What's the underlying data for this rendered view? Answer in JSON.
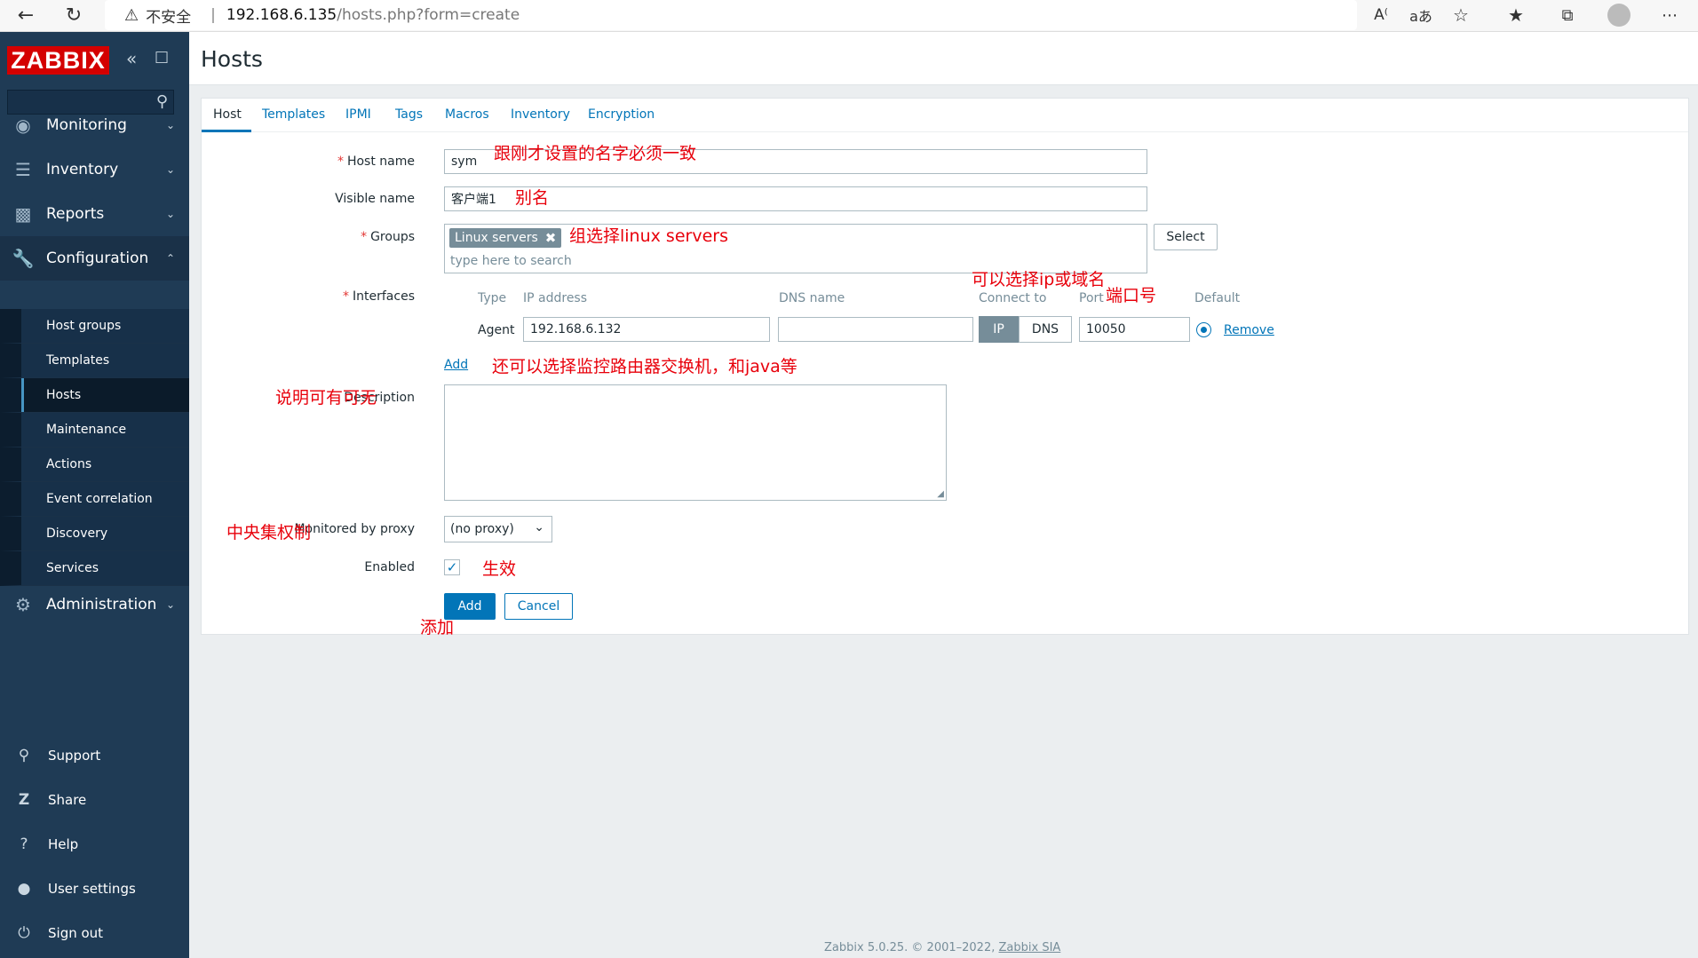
{
  "browser": {
    "insecure_label": "不安全",
    "url_host": "192.168.6.135",
    "url_path": "/hosts.php?form=create"
  },
  "sidebar": {
    "logo": "ZABBIX",
    "menu": [
      {
        "label": "Monitoring",
        "icon": "eye-icon"
      },
      {
        "label": "Inventory",
        "icon": "list-icon"
      },
      {
        "label": "Reports",
        "icon": "bar-chart-icon"
      },
      {
        "label": "Configuration",
        "icon": "wrench-icon"
      },
      {
        "label": "Administration",
        "icon": "gear-icon"
      }
    ],
    "submenu": [
      "Host groups",
      "Templates",
      "Hosts",
      "Maintenance",
      "Actions",
      "Event correlation",
      "Discovery",
      "Services"
    ],
    "bottom": [
      {
        "label": "Support",
        "icon": "headset-icon"
      },
      {
        "label": "Share",
        "icon": "share-icon"
      },
      {
        "label": "Help",
        "icon": "help-icon"
      },
      {
        "label": "User settings",
        "icon": "user-icon"
      },
      {
        "label": "Sign out",
        "icon": "power-icon"
      }
    ]
  },
  "page": {
    "title": "Hosts"
  },
  "tabs": [
    "Host",
    "Templates",
    "IPMI",
    "Tags",
    "Macros",
    "Inventory",
    "Encryption"
  ],
  "form": {
    "host_name_label": "Host name",
    "host_name_value": "sym",
    "visible_name_label": "Visible name",
    "visible_name_value": "客户端1",
    "groups_label": "Groups",
    "group_chip": "Linux servers",
    "groups_placeholder": "type here to search",
    "select_label": "Select",
    "interfaces_label": "Interfaces",
    "iface_cols": {
      "type": "Type",
      "ip": "IP address",
      "dns": "DNS name",
      "connect": "Connect to",
      "port": "Port",
      "default": "Default"
    },
    "iface_row": {
      "type": "Agent",
      "ip": "192.168.6.132",
      "dns": "",
      "ip_btn": "IP",
      "dns_btn": "DNS",
      "port": "10050",
      "remove": "Remove"
    },
    "add_iface": "Add",
    "description_label": "Description",
    "proxy_label": "Monitored by proxy",
    "proxy_value": "(no proxy)",
    "enabled_label": "Enabled",
    "add_btn": "Add",
    "cancel_btn": "Cancel"
  },
  "annotations": {
    "host_name": "跟刚才设置的名字必须一致",
    "visible_name": "别名",
    "groups": "组选择linux servers",
    "connect": "可以选择ip或域名",
    "port": "端口号",
    "add_iface": "还可以选择监控路由器交换机，和java等",
    "description": "说明可有可无",
    "proxy": "中央集权制",
    "enabled": "生效",
    "add": "添加"
  },
  "footer": {
    "text": "Zabbix 5.0.25. © 2001–2022, ",
    "link": "Zabbix SIA"
  }
}
